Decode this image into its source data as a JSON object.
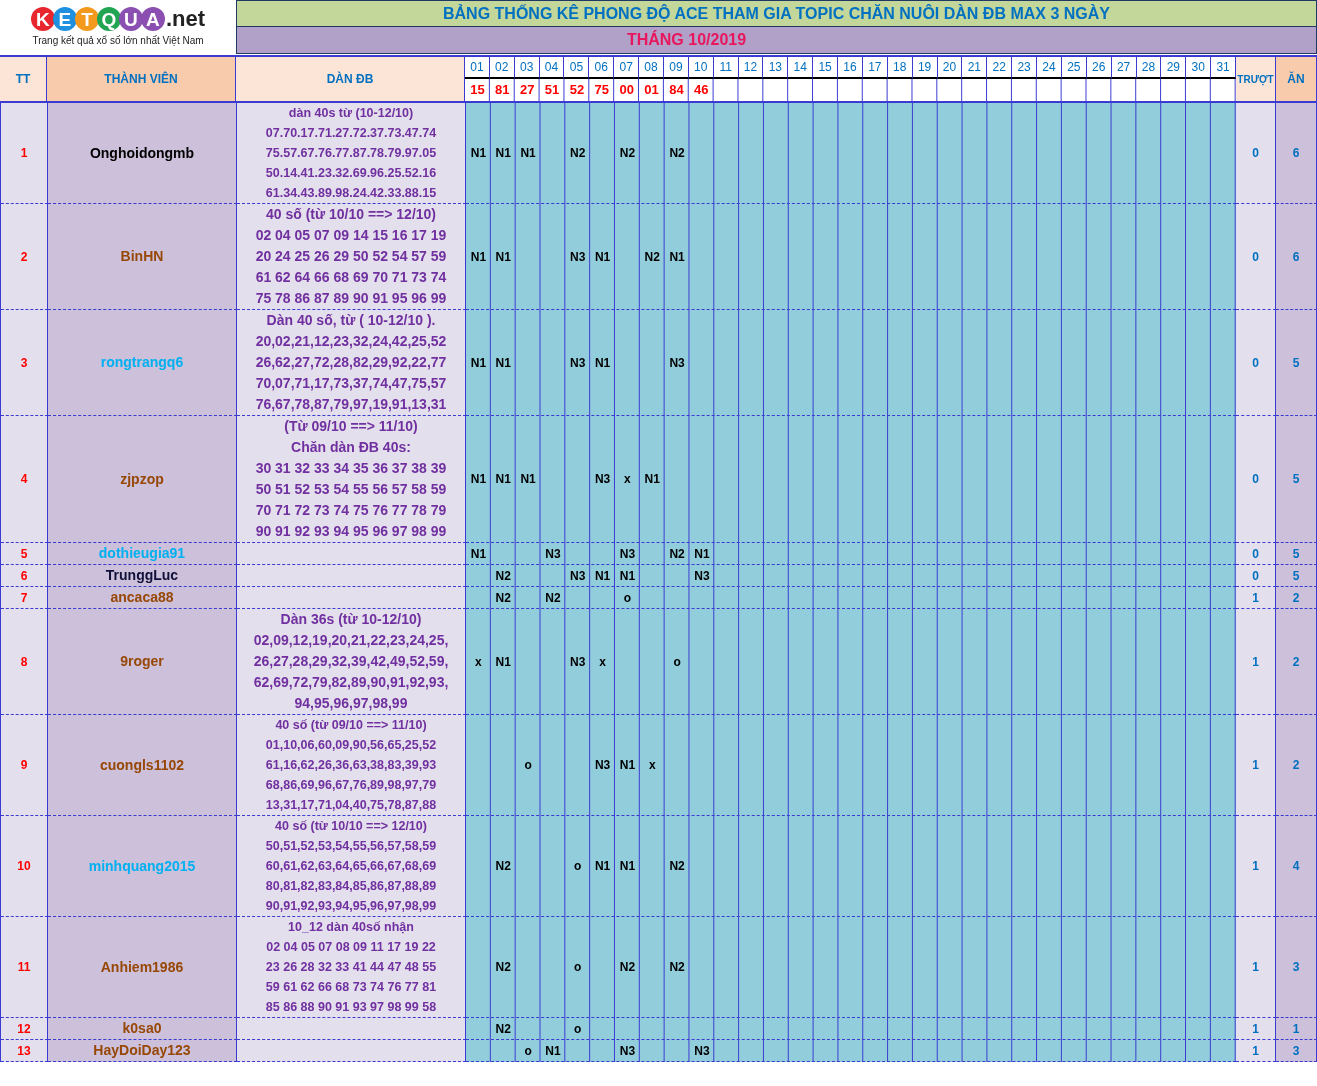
{
  "logo": {
    "letters": [
      {
        "text": "K",
        "color": "#e8262d"
      },
      {
        "text": "E",
        "color": "#1f8fe0"
      },
      {
        "text": "T",
        "color": "#f39a1e"
      },
      {
        "text": "Q",
        "color": "#22a552"
      },
      {
        "text": "U",
        "color": "#8a4fb0"
      },
      {
        "text": "A",
        "color": "#8a4fb0"
      }
    ],
    "suffix": ".net",
    "tagline": "Trang kết quả xổ số lớn nhất Việt Nam"
  },
  "title": "BẢNG THỐNG KÊ PHONG ĐỘ ACE THAM GIA TOPIC CHĂN NUÔI DÀN ĐB MAX 3 NGÀY",
  "month": "THÁNG 10/2019",
  "columns": {
    "index": "TT",
    "member": "THÀNH VIÊN",
    "numbers": "DÀN ĐB",
    "miss": "TRƯỢT",
    "win": "ĂN"
  },
  "days": [
    "01",
    "02",
    "03",
    "04",
    "05",
    "06",
    "07",
    "08",
    "09",
    "10",
    "11",
    "12",
    "13",
    "14",
    "15",
    "16",
    "17",
    "18",
    "19",
    "20",
    "21",
    "22",
    "23",
    "24",
    "25",
    "26",
    "27",
    "28",
    "29",
    "30",
    "31"
  ],
  "results": [
    "15",
    "81",
    "27",
    "51",
    "52",
    "75",
    "00",
    "01",
    "84",
    "46"
  ],
  "rows": [
    {
      "index": "1",
      "member": "Onghoidongmb",
      "color": "#000000",
      "numbers": {
        "kind": "small",
        "lines": [
          "dàn 40s từ (10-12/10)",
          "07.70.17.71.27.72.37.73.47.74",
          "75.57.67.76.77.87.78.79.97.05",
          "50.14.41.23.32.69.96.25.52.16",
          "61.34.43.89.98.24.42.33.88.15"
        ]
      },
      "marks": [
        {
          "kind": "mark",
          "text": "N1"
        },
        {
          "kind": "mark",
          "text": "N1"
        },
        {
          "kind": "mark",
          "text": "N1"
        },
        {
          "kind": "blank"
        },
        {
          "kind": "mark",
          "text": "N2"
        },
        {
          "kind": "blank"
        },
        {
          "kind": "mark",
          "text": "N2"
        },
        {
          "kind": "blank"
        },
        {
          "kind": "mark",
          "text": "N2"
        }
      ],
      "miss": "0",
      "win": "6"
    },
    {
      "index": "2",
      "member": "BinHN",
      "color": "#974706",
      "numbers": {
        "kind": "bold",
        "lines": [
          "40 số (từ 10/10 ==> 12/10)",
          "02 04 05 07 09 14 15 16 17 19",
          "20 24 25 26 29 50 52 54 57 59",
          "61 62 64 66 68 69 70 71 73 74",
          "75 78 86 87 89 90 91 95 96 99"
        ]
      },
      "marks": [
        {
          "kind": "mark",
          "text": "N1"
        },
        {
          "kind": "mark",
          "text": "N1"
        },
        {
          "kind": "blank"
        },
        {
          "kind": "blank"
        },
        {
          "kind": "mark",
          "text": "N3"
        },
        {
          "kind": "mark",
          "text": "N1"
        },
        {
          "kind": "blank"
        },
        {
          "kind": "mark",
          "text": "N2"
        },
        {
          "kind": "mark",
          "text": "N1"
        }
      ],
      "miss": "0",
      "win": "6"
    },
    {
      "index": "3",
      "member": "rongtrangq6",
      "color": "#00b0f0",
      "numbers": {
        "kind": "bold",
        "lines": [
          "Dàn 40 số, từ ( 10-12/10 ).",
          "20,02,21,12,23,32,24,42,25,52",
          "26,62,27,72,28,82,29,92,22,77",
          "70,07,71,17,73,37,74,47,75,57",
          "76,67,78,87,79,97,19,91,13,31"
        ]
      },
      "marks": [
        {
          "kind": "mark",
          "text": "N1"
        },
        {
          "kind": "mark",
          "text": "N1"
        },
        {
          "kind": "blank"
        },
        {
          "kind": "blank"
        },
        {
          "kind": "mark",
          "text": "N3"
        },
        {
          "kind": "mark",
          "text": "N1"
        },
        {
          "kind": "blank"
        },
        {
          "kind": "blank"
        },
        {
          "kind": "mark",
          "text": "N3"
        }
      ],
      "miss": "0",
      "win": "5"
    },
    {
      "index": "4",
      "member": "zjpzop",
      "color": "#974706",
      "numbers": {
        "kind": "bold",
        "lines": [
          "(Từ 09/10 ==> 11/10)",
          "Chăn dàn ĐB 40s:",
          "30 31 32 33 34 35 36 37 38 39",
          "50 51 52 53 54 55 56 57 58 59",
          "70 71 72 73 74 75 76 77 78 79",
          "90 91 92 93 94 95 96 97 98 99"
        ]
      },
      "marks": [
        {
          "kind": "mark",
          "text": "N1"
        },
        {
          "kind": "mark",
          "text": "N1"
        },
        {
          "kind": "mark",
          "text": "N1"
        },
        {
          "kind": "blank"
        },
        {
          "kind": "blank"
        },
        {
          "kind": "mark",
          "text": "N3"
        },
        {
          "kind": "mark",
          "text": "x"
        },
        {
          "kind": "mark",
          "text": "N1"
        }
      ],
      "miss": "0",
      "win": "5"
    },
    {
      "index": "5",
      "member": "dothieugia91",
      "color": "#00b0f0",
      "marks": [
        {
          "kind": "mark",
          "text": "N1"
        },
        {
          "kind": "blank"
        },
        {
          "kind": "blank"
        },
        {
          "kind": "mark",
          "text": "N3"
        },
        {
          "kind": "blank"
        },
        {
          "kind": "blank"
        },
        {
          "kind": "mark",
          "text": "N3"
        },
        {
          "kind": "blank"
        },
        {
          "kind": "mark",
          "text": "N2"
        },
        {
          "kind": "mark",
          "text": "N1"
        }
      ],
      "miss": "0",
      "win": "5"
    },
    {
      "index": "6",
      "member": "TrunggLuc",
      "color": "#10103a",
      "marks": [
        {
          "kind": "blank"
        },
        {
          "kind": "mark",
          "text": "N2"
        },
        {
          "kind": "blank"
        },
        {
          "kind": "blank"
        },
        {
          "kind": "mark",
          "text": "N3"
        },
        {
          "kind": "mark",
          "text": "N1"
        },
        {
          "kind": "mark",
          "text": "N1"
        },
        {
          "kind": "blank"
        },
        {
          "kind": "blank"
        },
        {
          "kind": "mark",
          "text": "N3"
        }
      ],
      "miss": "0",
      "win": "5"
    },
    {
      "index": "7",
      "member": "ancaca88",
      "color": "#974706",
      "marks": [
        {
          "kind": "blank"
        },
        {
          "kind": "mark",
          "text": "N2"
        },
        {
          "kind": "blank"
        },
        {
          "kind": "mark",
          "text": "N2"
        },
        {
          "kind": "blank"
        },
        {
          "kind": "blank"
        },
        {
          "kind": "mark",
          "text": "o"
        }
      ],
      "miss": "1",
      "win": "2"
    },
    {
      "index": "8",
      "member": "9roger",
      "color": "#974706",
      "numbers": {
        "kind": "bold",
        "lines": [
          "Dàn 36s (từ 10-12/10)",
          "02,09,12,19,20,21,22,23,24,25,",
          "26,27,28,29,32,39,42,49,52,59,",
          "62,69,72,79,82,89,90,91,92,93,",
          "94,95,96,97,98,99"
        ]
      },
      "marks": [
        {
          "kind": "mark",
          "text": "x"
        },
        {
          "kind": "mark",
          "text": "N1"
        },
        {
          "kind": "blank"
        },
        {
          "kind": "blank"
        },
        {
          "kind": "mark",
          "text": "N3"
        },
        {
          "kind": "mark",
          "text": "x"
        },
        {
          "kind": "blank"
        },
        {
          "kind": "blank"
        },
        {
          "kind": "mark",
          "text": "o"
        }
      ],
      "miss": "1",
      "win": "2"
    },
    {
      "index": "9",
      "member": "cuongls1102",
      "color": "#974706",
      "numbers": {
        "kind": "small",
        "lines": [
          "40 số (từ 09/10 ==> 11/10)",
          "01,10,06,60,09,90,56,65,25,52",
          "61,16,62,26,36,63,38,83,39,93",
          "68,86,69,96,67,76,89,98,97,79",
          "13,31,17,71,04,40,75,78,87,88"
        ]
      },
      "marks": [
        {
          "kind": "blank"
        },
        {
          "kind": "blank"
        },
        {
          "kind": "mark",
          "text": "o"
        },
        {
          "kind": "blank"
        },
        {
          "kind": "blank"
        },
        {
          "kind": "mark",
          "text": "N3"
        },
        {
          "kind": "mark",
          "text": "N1"
        },
        {
          "kind": "mark",
          "text": "x"
        }
      ],
      "miss": "1",
      "win": "2"
    },
    {
      "index": "10",
      "member": "minhquang2015",
      "color": "#00b0f0",
      "numbers": {
        "kind": "small",
        "lines": [
          "40 số (từ 10/10 ==> 12/10)",
          "50,51,52,53,54,55,56,57,58,59",
          "60,61,62,63,64,65,66,67,68,69",
          "80,81,82,83,84,85,86,87,88,89",
          "90,91,92,93,94,95,96,97,98,99"
        ]
      },
      "marks": [
        {
          "kind": "blank"
        },
        {
          "kind": "mark",
          "text": "N2"
        },
        {
          "kind": "blank"
        },
        {
          "kind": "blank"
        },
        {
          "kind": "mark",
          "text": "o"
        },
        {
          "kind": "mark",
          "text": "N1"
        },
        {
          "kind": "mark",
          "text": "N1"
        },
        {
          "kind": "blank"
        },
        {
          "kind": "mark",
          "text": "N2"
        }
      ],
      "miss": "1",
      "win": "4"
    },
    {
      "index": "11",
      "member": "Anhiem1986",
      "color": "#974706",
      "numbers": {
        "kind": "small",
        "lines": [
          "10_12 dàn 40số nhận",
          "02 04 05 07 08 09 11 17 19 22",
          "23 26 28 32 33 41 44 47 48 55",
          "59 61 62 66 68 73 74 76 77 81",
          "85 86 88 90 91 93 97 98 99 58"
        ]
      },
      "marks": [
        {
          "kind": "blank"
        },
        {
          "kind": "mark",
          "text": "N2"
        },
        {
          "kind": "blank"
        },
        {
          "kind": "blank"
        },
        {
          "kind": "mark",
          "text": "o"
        },
        {
          "kind": "blank"
        },
        {
          "kind": "mark",
          "text": "N2"
        },
        {
          "kind": "blank"
        },
        {
          "kind": "mark",
          "text": "N2"
        }
      ],
      "miss": "1",
      "win": "3"
    },
    {
      "index": "12",
      "member": "k0sa0",
      "color": "#974706",
      "marks": [
        {
          "kind": "blank"
        },
        {
          "kind": "mark",
          "text": "N2"
        },
        {
          "kind": "blank"
        },
        {
          "kind": "blank"
        },
        {
          "kind": "mark",
          "text": "o"
        }
      ],
      "miss": "1",
      "win": "1"
    },
    {
      "index": "13",
      "member": "HayDoiDay123",
      "color": "#974706",
      "marks": [
        {
          "kind": "blank"
        },
        {
          "kind": "blank"
        },
        {
          "kind": "mark",
          "text": "o"
        },
        {
          "kind": "mark",
          "text": "N1"
        },
        {
          "kind": "blank"
        },
        {
          "kind": "blank"
        },
        {
          "kind": "mark",
          "text": "N3"
        },
        {
          "kind": "blank"
        },
        {
          "kind": "blank"
        },
        {
          "kind": "mark",
          "text": "N3"
        }
      ],
      "miss": "1",
      "win": "3"
    }
  ]
}
